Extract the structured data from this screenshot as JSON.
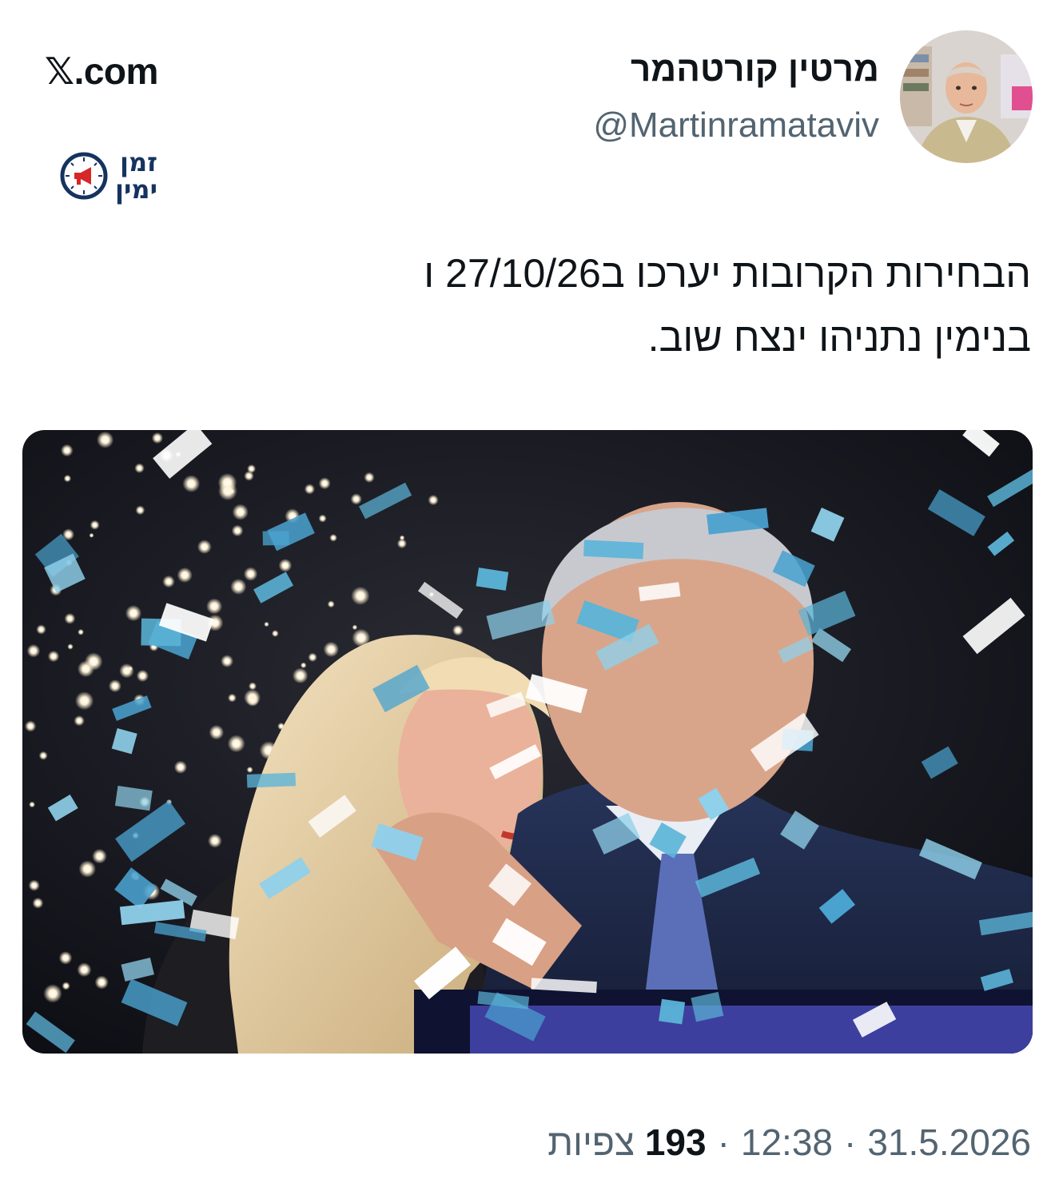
{
  "site": {
    "domain": "X.com",
    "x_glyph": "𝕏",
    "rest": ".com"
  },
  "brand": {
    "line1": "זמן",
    "line2": "ימין",
    "icon": "clock-megaphone-icon",
    "color": "#16335f",
    "accent": "#d62828"
  },
  "author": {
    "display_name": "מרטין קורטהמר",
    "handle": "@Martinramataviv",
    "avatar_icon": "profile-photo"
  },
  "tweet": {
    "line1": "הבחירות הקרובות יערכו ב27/10/26 ו",
    "line2": "בנימין נתניהו ינצח שוב."
  },
  "media": {
    "kind": "photo",
    "subject": "celebration-confetti-photo"
  },
  "meta": {
    "date": "31.5.2026",
    "time": "12:38",
    "views_count": "193",
    "views_label": "צפיות",
    "separator": "·"
  }
}
